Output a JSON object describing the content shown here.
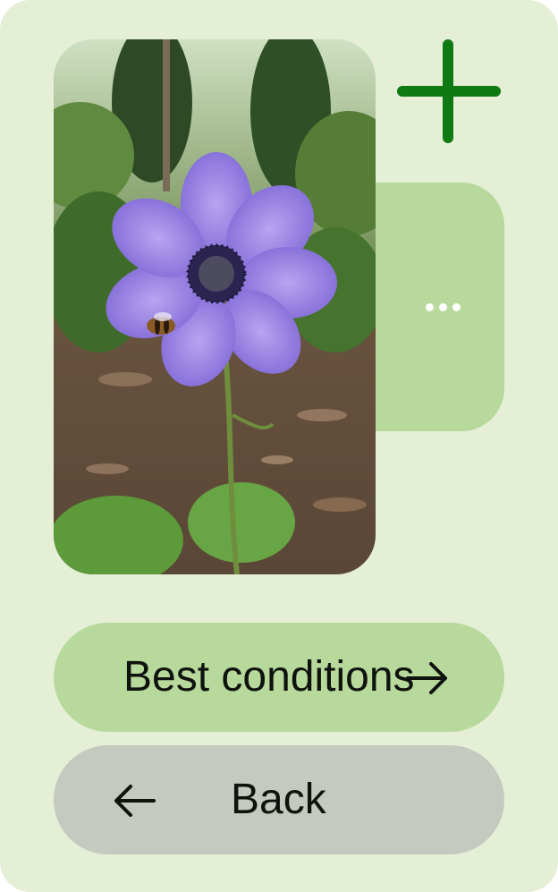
{
  "photo": {
    "subject": "purple anemone flower with bee in garden"
  },
  "actions": {
    "add_icon": "plus-icon",
    "more_icon": "more-horizontal-icon"
  },
  "buttons": {
    "best_conditions": {
      "label": "Best conditions",
      "icon": "arrow-right-icon"
    },
    "back": {
      "label": "Back",
      "icon": "arrow-left-icon"
    }
  },
  "colors": {
    "background": "#e4efd6",
    "accent_green": "#0f7a12",
    "card_green": "#b7d99c",
    "back_gray": "#c5c9bf"
  }
}
